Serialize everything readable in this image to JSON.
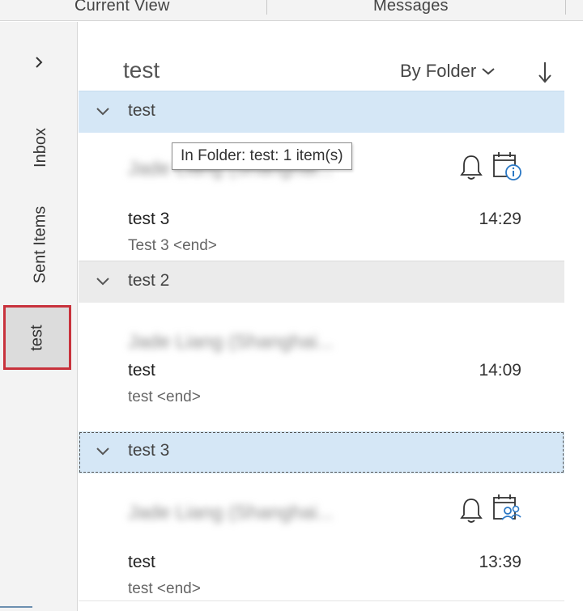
{
  "ribbon": {
    "group_labels": [
      "Current View",
      "Messages"
    ]
  },
  "folder_pane": {
    "folders": [
      {
        "label": "Inbox",
        "selected": false
      },
      {
        "label": "Sent Items",
        "selected": false
      },
      {
        "label": "test",
        "selected": true
      }
    ]
  },
  "list_header": {
    "folder_title": "test",
    "sort_by": "By Folder"
  },
  "tooltip": "In Folder: test: 1 item(s)",
  "groups": [
    {
      "label": "test",
      "message": {
        "sender": "Jade Liang (Shanghai...",
        "subject": "test 3",
        "preview": "Test 3 <end>",
        "time": "14:29",
        "icons": [
          "reminder-bell-icon",
          "meeting-info-icon"
        ]
      }
    },
    {
      "label": "test 2",
      "message": {
        "sender": "Jade Liang (Shanghai...",
        "subject": "test",
        "preview": "test <end>",
        "time": "14:09",
        "icons": []
      }
    },
    {
      "label": "test 3",
      "message": {
        "sender": "Jade Liang (Shanghai...",
        "subject": "test",
        "preview": "test <end>",
        "time": "13:39",
        "icons": [
          "reminder-bell-icon",
          "meeting-attendee-icon"
        ]
      }
    }
  ],
  "colors": {
    "selected_folder_border": "#c8323c",
    "group_header_blue": "#d5e7f6",
    "group_header_grey": "#ebebeb",
    "accent_blue": "#2b78c5"
  }
}
